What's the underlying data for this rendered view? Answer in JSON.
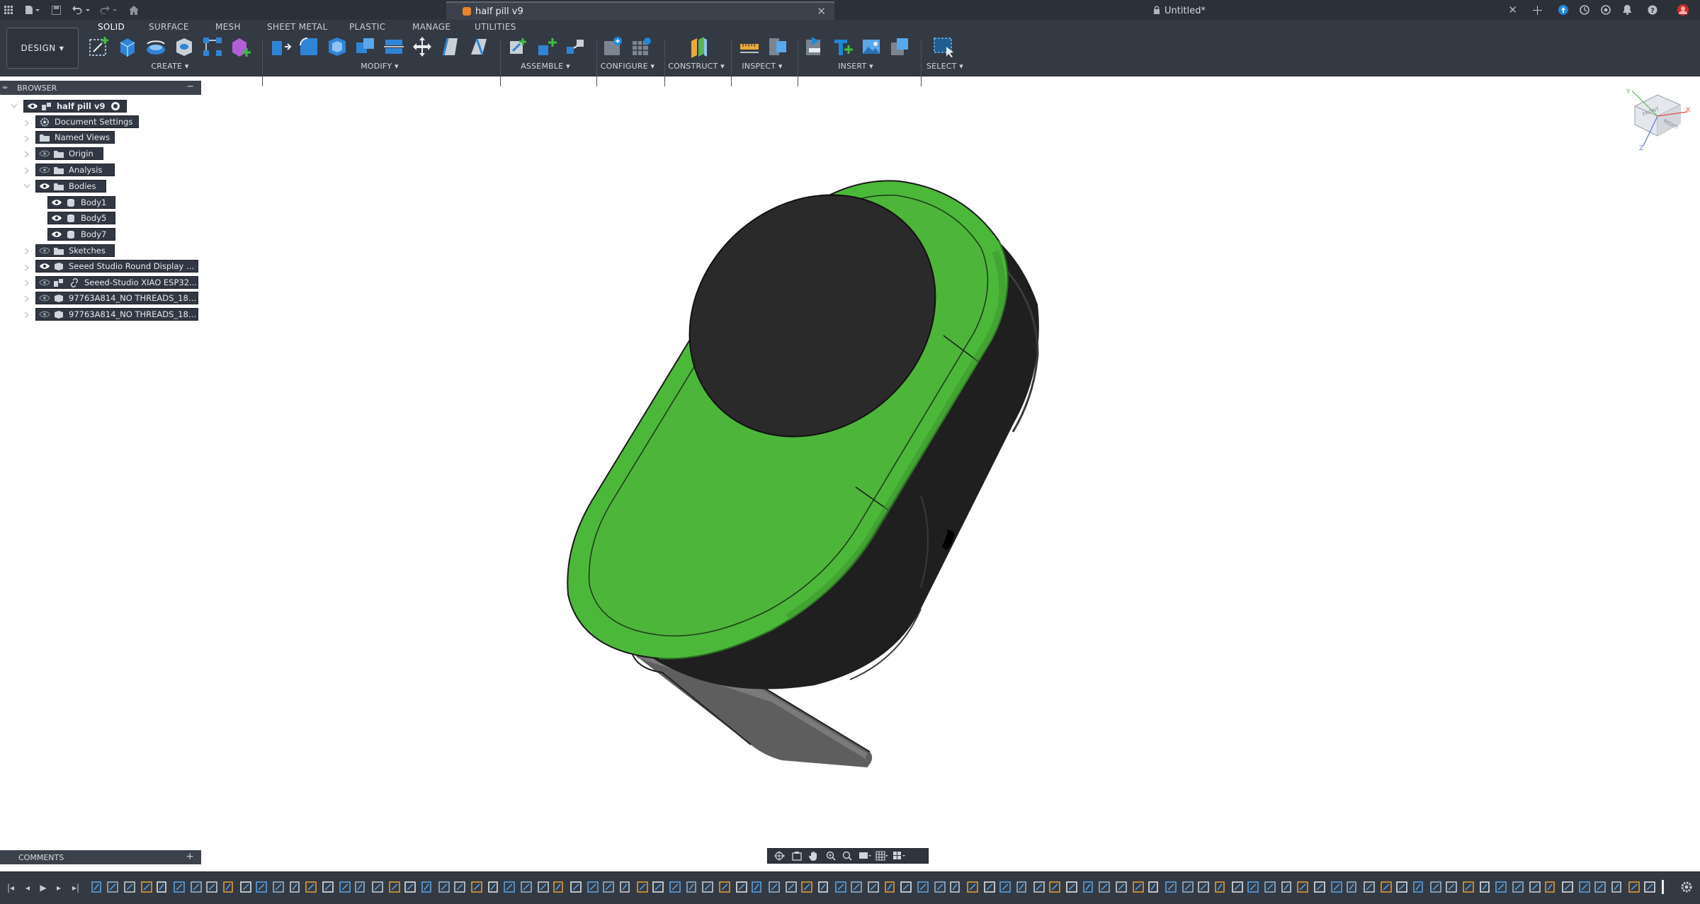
{
  "titlebar": {
    "active_tab_title": "half pill v9",
    "inactive_tab_title": "Untitled*"
  },
  "workspace": {
    "mode_label": "DESIGN",
    "tabs": [
      "SOLID",
      "SURFACE",
      "MESH",
      "SHEET METAL",
      "PLASTIC",
      "MANAGE",
      "UTILITIES"
    ],
    "active_tab": "SOLID"
  },
  "toolbar": {
    "groups": {
      "create": "CREATE",
      "modify": "MODIFY",
      "assemble": "ASSEMBLE",
      "configure": "CONFIGURE",
      "construct": "CONSTRUCT",
      "inspect": "INSPECT",
      "insert": "INSERT",
      "select": "SELECT"
    }
  },
  "browser": {
    "title": "BROWSER",
    "root": "half pill v9",
    "items": [
      {
        "label": "Document Settings",
        "icon": "gear-icon"
      },
      {
        "label": "Named Views",
        "icon": "folder-icon"
      },
      {
        "label": "Origin",
        "icon": "folder-icon"
      },
      {
        "label": "Analysis",
        "icon": "folder-icon"
      },
      {
        "label": "Bodies",
        "icon": "folder-icon",
        "expanded": true
      },
      {
        "label": "Body1",
        "icon": "body-icon"
      },
      {
        "label": "Body5",
        "icon": "body-icon"
      },
      {
        "label": "Body7",
        "icon": "body-icon"
      },
      {
        "label": "Sketches",
        "icon": "folder-icon"
      },
      {
        "label": "Seeed Studio Round Display v...",
        "icon": "component-icon"
      },
      {
        "label": "Seeed-Studio XIAO ESP32...",
        "icon": "linked-component-icon"
      },
      {
        "label": "97763A814_NO THREADS_18-8...",
        "icon": "component-icon"
      },
      {
        "label": "97763A814_NO THREADS_18-8...",
        "icon": "component-icon"
      }
    ]
  },
  "comments": {
    "title": "COMMENTS"
  },
  "viewcube": {
    "front": "FRONT",
    "right": "RIGHT",
    "axis_x": "X",
    "axis_y": "Y",
    "axis_z": "Z"
  },
  "colors": {
    "body_green": "#4cb83a",
    "body_black": "#1d1d1d",
    "display_dark": "#2a2a2a",
    "accent_blue": "#0696d7",
    "toolbar_bg": "#343a43",
    "titlebar_bg": "#2c3139"
  }
}
